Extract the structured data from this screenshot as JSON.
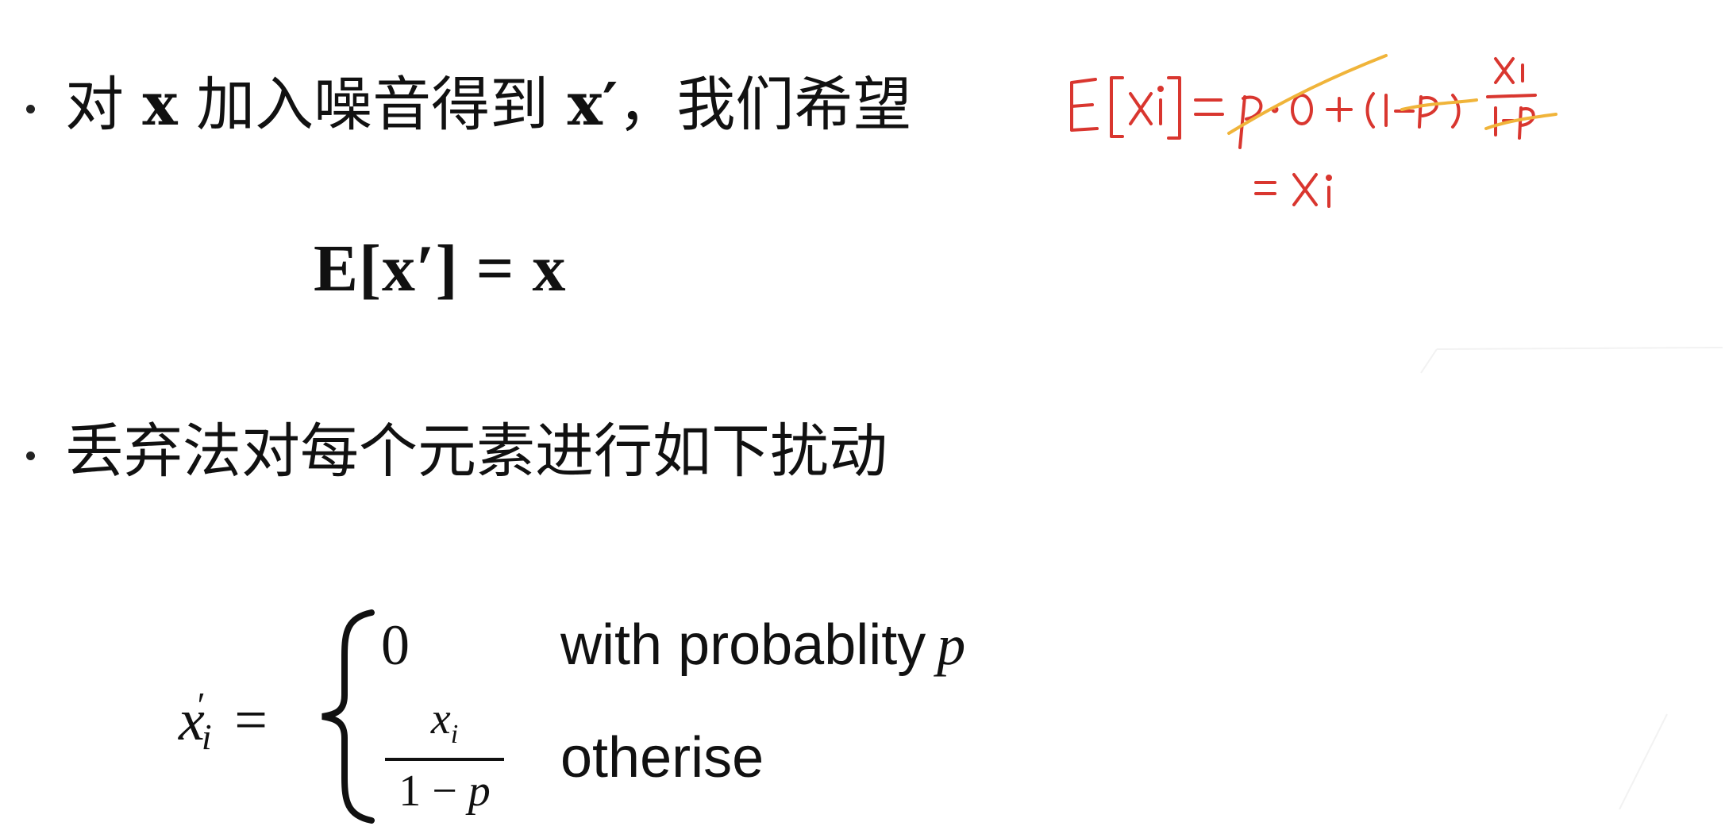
{
  "bullets": {
    "line1": {
      "prefix": "对",
      "var1": "x",
      "middle": "加入噪音得到",
      "var2": "x′",
      "suffix": "，我们希望"
    },
    "line2": {
      "text": "丢弃法对每个元素进行如下扰动"
    }
  },
  "equation_main": "E[x′] = x",
  "piecewise": {
    "lhs_var": "x",
    "lhs_sub": "i",
    "lhs_prime": "′",
    "equals": "=",
    "case1_value": "0",
    "case1_condition": "with probablity",
    "case1_condition_var": "p",
    "case2_numerator_var": "x",
    "case2_numerator_sub": "i",
    "case2_denominator_left": "1 − ",
    "case2_denominator_var": "p",
    "case2_condition": "otherise"
  },
  "annotation": {
    "line1": "E[xi] = p·0 + (1−p) xi/(1−p)",
    "line2": "= xi",
    "ink_color": "#d9362f",
    "strike_color": "#f0b43a"
  }
}
